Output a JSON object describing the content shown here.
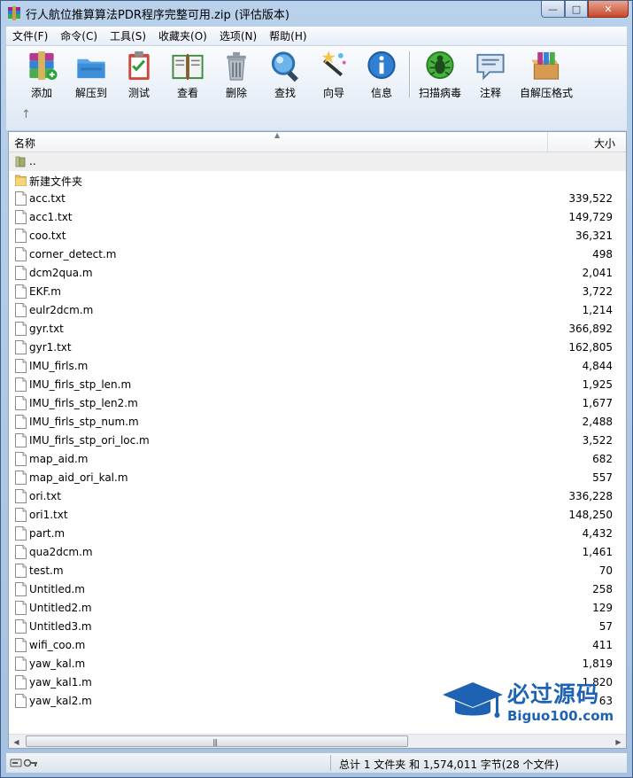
{
  "window": {
    "title": "行人航位推算算法PDR程序完整可用.zip (评估版本)",
    "controls": {
      "minimize": "—",
      "maximize": "□",
      "close": "✕"
    }
  },
  "menu": [
    "文件(F)",
    "命令(C)",
    "工具(S)",
    "收藏夹(O)",
    "选项(N)",
    "帮助(H)"
  ],
  "toolbar": [
    {
      "label": "添加",
      "icon": "add-archive-icon"
    },
    {
      "label": "解压到",
      "icon": "extract-to-icon"
    },
    {
      "label": "测试",
      "icon": "test-icon"
    },
    {
      "label": "查看",
      "icon": "view-icon"
    },
    {
      "label": "删除",
      "icon": "delete-icon"
    },
    {
      "label": "查找",
      "icon": "find-icon"
    },
    {
      "label": "向导",
      "icon": "wizard-icon"
    },
    {
      "label": "信息",
      "icon": "info-icon"
    },
    {
      "label": "扫描病毒",
      "icon": "virus-scan-icon"
    },
    {
      "label": "注释",
      "icon": "comment-icon"
    },
    {
      "label": "自解压格式",
      "icon": "sfx-icon"
    }
  ],
  "columns": {
    "name": "名称",
    "size": "大小"
  },
  "files": [
    {
      "name": "..",
      "size": "",
      "type": "parent"
    },
    {
      "name": "新建文件夹",
      "size": "",
      "type": "folder"
    },
    {
      "name": "acc.txt",
      "size": "339,522",
      "type": "file"
    },
    {
      "name": "acc1.txt",
      "size": "149,729",
      "type": "file"
    },
    {
      "name": "coo.txt",
      "size": "36,321",
      "type": "file"
    },
    {
      "name": "corner_detect.m",
      "size": "498",
      "type": "file"
    },
    {
      "name": "dcm2qua.m",
      "size": "2,041",
      "type": "file"
    },
    {
      "name": "EKF.m",
      "size": "3,722",
      "type": "file"
    },
    {
      "name": "eulr2dcm.m",
      "size": "1,214",
      "type": "file"
    },
    {
      "name": "gyr.txt",
      "size": "366,892",
      "type": "file"
    },
    {
      "name": "gyr1.txt",
      "size": "162,805",
      "type": "file"
    },
    {
      "name": "IMU_firls.m",
      "size": "4,844",
      "type": "file"
    },
    {
      "name": "IMU_firls_stp_len.m",
      "size": "1,925",
      "type": "file"
    },
    {
      "name": "IMU_firls_stp_len2.m",
      "size": "1,677",
      "type": "file"
    },
    {
      "name": "IMU_firls_stp_num.m",
      "size": "2,488",
      "type": "file"
    },
    {
      "name": "IMU_firls_stp_ori_loc.m",
      "size": "3,522",
      "type": "file"
    },
    {
      "name": "map_aid.m",
      "size": "682",
      "type": "file"
    },
    {
      "name": "map_aid_ori_kal.m",
      "size": "557",
      "type": "file"
    },
    {
      "name": "ori.txt",
      "size": "336,228",
      "type": "file"
    },
    {
      "name": "ori1.txt",
      "size": "148,250",
      "type": "file"
    },
    {
      "name": "part.m",
      "size": "4,432",
      "type": "file"
    },
    {
      "name": "qua2dcm.m",
      "size": "1,461",
      "type": "file"
    },
    {
      "name": "test.m",
      "size": "70",
      "type": "file"
    },
    {
      "name": "Untitled.m",
      "size": "258",
      "type": "file"
    },
    {
      "name": "Untitled2.m",
      "size": "129",
      "type": "file"
    },
    {
      "name": "Untitled3.m",
      "size": "57",
      "type": "file"
    },
    {
      "name": "wifi_coo.m",
      "size": "411",
      "type": "file"
    },
    {
      "name": "yaw_kal.m",
      "size": "1,819",
      "type": "file"
    },
    {
      "name": "yaw_kal1.m",
      "size": "1,820",
      "type": "file"
    },
    {
      "name": "yaw_kal2.m",
      "size": "63",
      "type": "file"
    }
  ],
  "status": {
    "summary": "总计 1 文件夹 和 1,574,011 字节(28 个文件)"
  },
  "watermark": {
    "cn": "必过源码",
    "en": "Biguo100.com"
  },
  "colors": {
    "accent": "#1e62b4",
    "window": "#b9d1ea"
  }
}
